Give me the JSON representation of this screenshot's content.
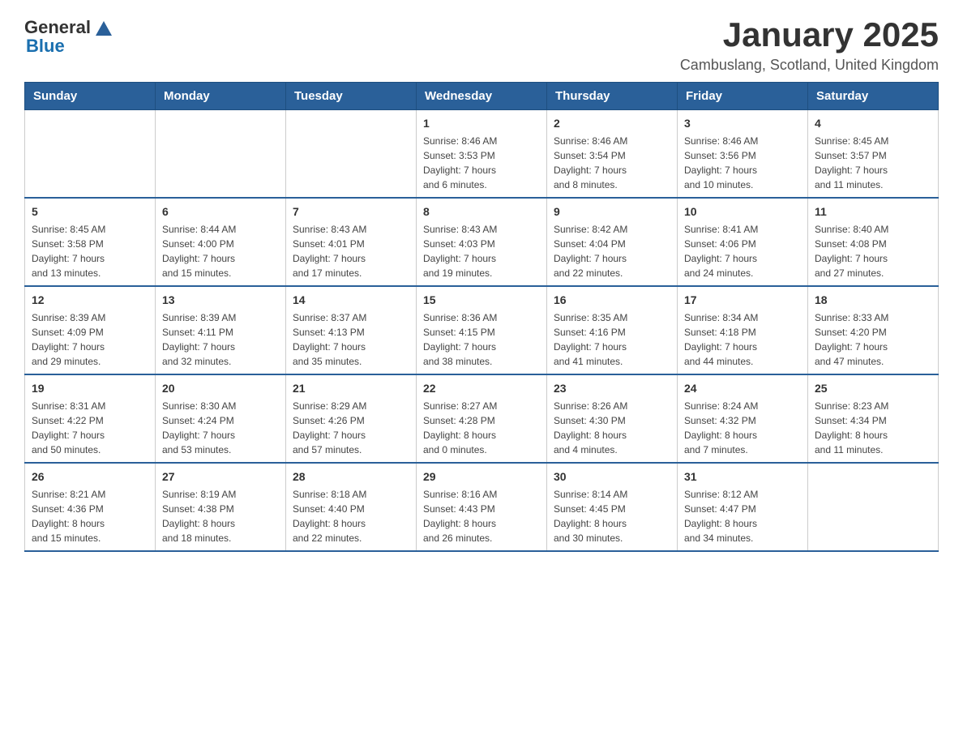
{
  "header": {
    "logo_general": "General",
    "logo_blue": "Blue",
    "title": "January 2025",
    "subtitle": "Cambuslang, Scotland, United Kingdom"
  },
  "days_of_week": [
    "Sunday",
    "Monday",
    "Tuesday",
    "Wednesday",
    "Thursday",
    "Friday",
    "Saturday"
  ],
  "weeks": [
    [
      {
        "day": "",
        "info": ""
      },
      {
        "day": "",
        "info": ""
      },
      {
        "day": "",
        "info": ""
      },
      {
        "day": "1",
        "info": "Sunrise: 8:46 AM\nSunset: 3:53 PM\nDaylight: 7 hours\nand 6 minutes."
      },
      {
        "day": "2",
        "info": "Sunrise: 8:46 AM\nSunset: 3:54 PM\nDaylight: 7 hours\nand 8 minutes."
      },
      {
        "day": "3",
        "info": "Sunrise: 8:46 AM\nSunset: 3:56 PM\nDaylight: 7 hours\nand 10 minutes."
      },
      {
        "day": "4",
        "info": "Sunrise: 8:45 AM\nSunset: 3:57 PM\nDaylight: 7 hours\nand 11 minutes."
      }
    ],
    [
      {
        "day": "5",
        "info": "Sunrise: 8:45 AM\nSunset: 3:58 PM\nDaylight: 7 hours\nand 13 minutes."
      },
      {
        "day": "6",
        "info": "Sunrise: 8:44 AM\nSunset: 4:00 PM\nDaylight: 7 hours\nand 15 minutes."
      },
      {
        "day": "7",
        "info": "Sunrise: 8:43 AM\nSunset: 4:01 PM\nDaylight: 7 hours\nand 17 minutes."
      },
      {
        "day": "8",
        "info": "Sunrise: 8:43 AM\nSunset: 4:03 PM\nDaylight: 7 hours\nand 19 minutes."
      },
      {
        "day": "9",
        "info": "Sunrise: 8:42 AM\nSunset: 4:04 PM\nDaylight: 7 hours\nand 22 minutes."
      },
      {
        "day": "10",
        "info": "Sunrise: 8:41 AM\nSunset: 4:06 PM\nDaylight: 7 hours\nand 24 minutes."
      },
      {
        "day": "11",
        "info": "Sunrise: 8:40 AM\nSunset: 4:08 PM\nDaylight: 7 hours\nand 27 minutes."
      }
    ],
    [
      {
        "day": "12",
        "info": "Sunrise: 8:39 AM\nSunset: 4:09 PM\nDaylight: 7 hours\nand 29 minutes."
      },
      {
        "day": "13",
        "info": "Sunrise: 8:39 AM\nSunset: 4:11 PM\nDaylight: 7 hours\nand 32 minutes."
      },
      {
        "day": "14",
        "info": "Sunrise: 8:37 AM\nSunset: 4:13 PM\nDaylight: 7 hours\nand 35 minutes."
      },
      {
        "day": "15",
        "info": "Sunrise: 8:36 AM\nSunset: 4:15 PM\nDaylight: 7 hours\nand 38 minutes."
      },
      {
        "day": "16",
        "info": "Sunrise: 8:35 AM\nSunset: 4:16 PM\nDaylight: 7 hours\nand 41 minutes."
      },
      {
        "day": "17",
        "info": "Sunrise: 8:34 AM\nSunset: 4:18 PM\nDaylight: 7 hours\nand 44 minutes."
      },
      {
        "day": "18",
        "info": "Sunrise: 8:33 AM\nSunset: 4:20 PM\nDaylight: 7 hours\nand 47 minutes."
      }
    ],
    [
      {
        "day": "19",
        "info": "Sunrise: 8:31 AM\nSunset: 4:22 PM\nDaylight: 7 hours\nand 50 minutes."
      },
      {
        "day": "20",
        "info": "Sunrise: 8:30 AM\nSunset: 4:24 PM\nDaylight: 7 hours\nand 53 minutes."
      },
      {
        "day": "21",
        "info": "Sunrise: 8:29 AM\nSunset: 4:26 PM\nDaylight: 7 hours\nand 57 minutes."
      },
      {
        "day": "22",
        "info": "Sunrise: 8:27 AM\nSunset: 4:28 PM\nDaylight: 8 hours\nand 0 minutes."
      },
      {
        "day": "23",
        "info": "Sunrise: 8:26 AM\nSunset: 4:30 PM\nDaylight: 8 hours\nand 4 minutes."
      },
      {
        "day": "24",
        "info": "Sunrise: 8:24 AM\nSunset: 4:32 PM\nDaylight: 8 hours\nand 7 minutes."
      },
      {
        "day": "25",
        "info": "Sunrise: 8:23 AM\nSunset: 4:34 PM\nDaylight: 8 hours\nand 11 minutes."
      }
    ],
    [
      {
        "day": "26",
        "info": "Sunrise: 8:21 AM\nSunset: 4:36 PM\nDaylight: 8 hours\nand 15 minutes."
      },
      {
        "day": "27",
        "info": "Sunrise: 8:19 AM\nSunset: 4:38 PM\nDaylight: 8 hours\nand 18 minutes."
      },
      {
        "day": "28",
        "info": "Sunrise: 8:18 AM\nSunset: 4:40 PM\nDaylight: 8 hours\nand 22 minutes."
      },
      {
        "day": "29",
        "info": "Sunrise: 8:16 AM\nSunset: 4:43 PM\nDaylight: 8 hours\nand 26 minutes."
      },
      {
        "day": "30",
        "info": "Sunrise: 8:14 AM\nSunset: 4:45 PM\nDaylight: 8 hours\nand 30 minutes."
      },
      {
        "day": "31",
        "info": "Sunrise: 8:12 AM\nSunset: 4:47 PM\nDaylight: 8 hours\nand 34 minutes."
      },
      {
        "day": "",
        "info": ""
      }
    ]
  ]
}
